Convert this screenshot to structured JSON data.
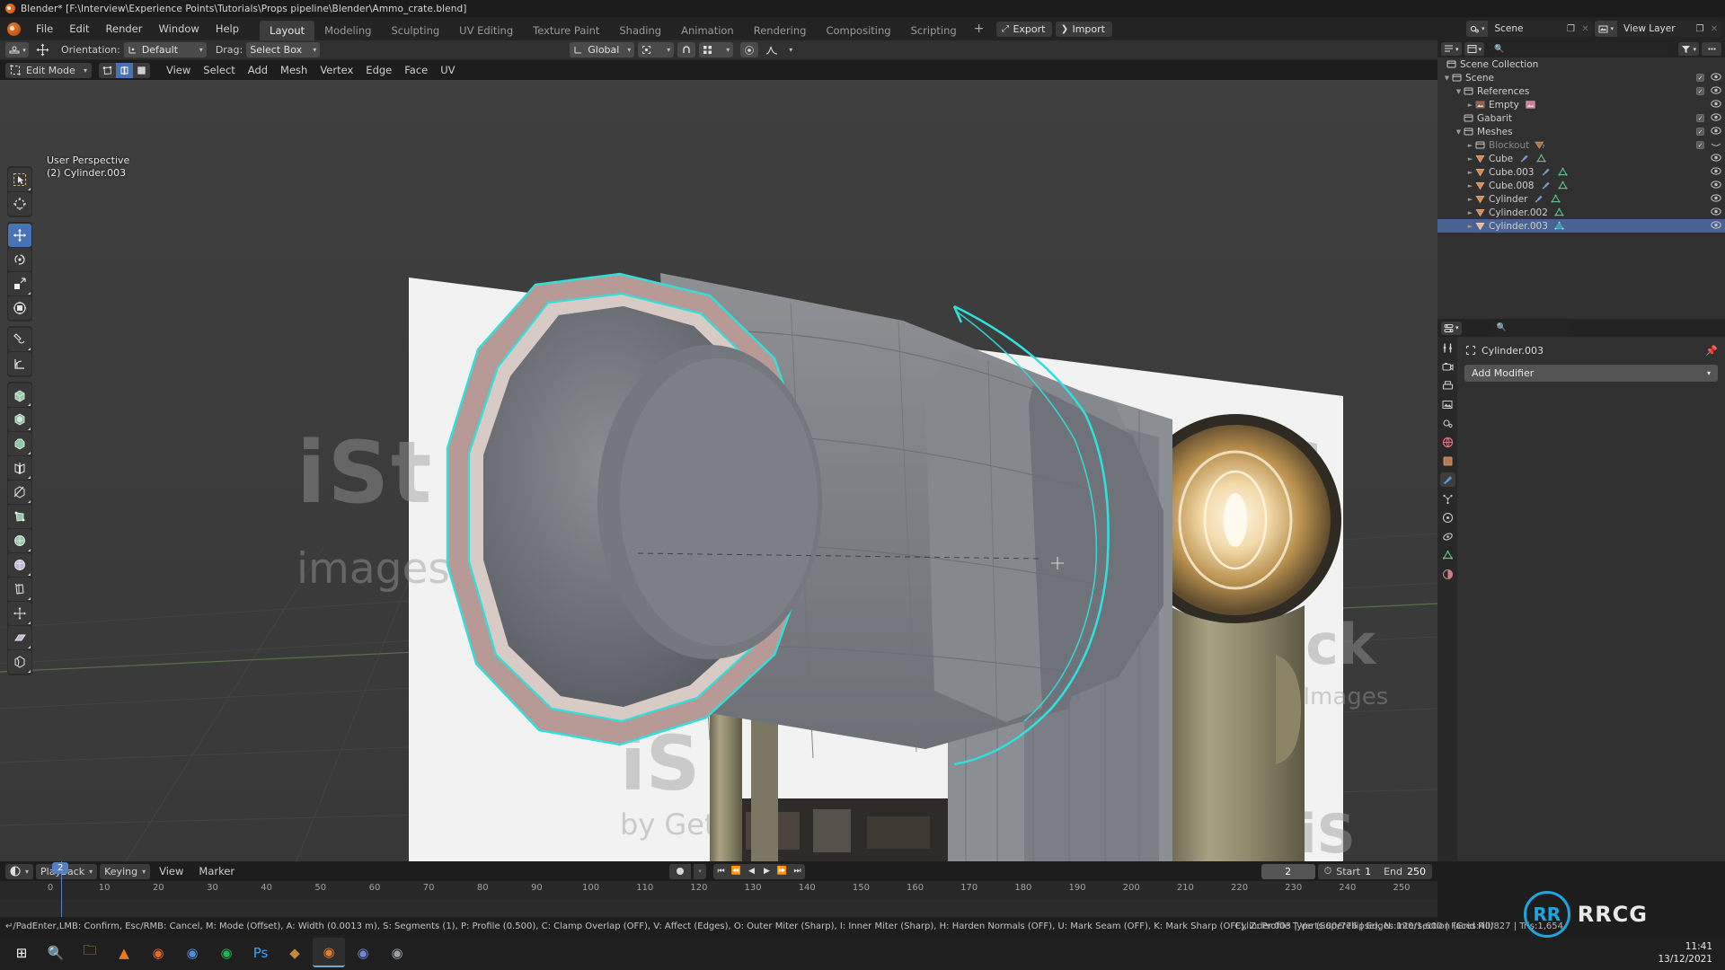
{
  "window": {
    "title": "Blender* [F:\\Interview\\Experience Points\\Tutorials\\Props pipeline\\Blender\\Ammo_crate.blend]",
    "logo_icon": "blender-logo-icon"
  },
  "topbar": {
    "menus": [
      "File",
      "Edit",
      "Render",
      "Window",
      "Help"
    ],
    "workspaces": [
      {
        "label": "Layout",
        "active": true
      },
      {
        "label": "Modeling",
        "active": false
      },
      {
        "label": "Sculpting",
        "active": false
      },
      {
        "label": "UV Editing",
        "active": false
      },
      {
        "label": "Texture Paint",
        "active": false
      },
      {
        "label": "Shading",
        "active": false
      },
      {
        "label": "Animation",
        "active": false
      },
      {
        "label": "Rendering",
        "active": false
      },
      {
        "label": "Compositing",
        "active": false
      },
      {
        "label": "Scripting",
        "active": false
      }
    ],
    "add_workspace": "+",
    "pills": [
      {
        "label": "Export",
        "icon": "export-icon"
      },
      {
        "label": "Import",
        "icon": "import-icon"
      }
    ],
    "scene_field": {
      "icon": "scene-icon",
      "value": "Scene",
      "copy": "new-scene-icon",
      "close": "x-icon"
    },
    "viewlayer_field": {
      "icon": "viewlayer-icon",
      "value": "View Layer",
      "copy": "new-layer-icon",
      "close": "x-icon"
    }
  },
  "tool_settings": {
    "active_tool_icon": "move-tool-icon",
    "gizmo_icon": "transform-gizmo-icon",
    "orientation_label": "Orientation:",
    "orientation_value": "Default",
    "drag_label": "Drag:",
    "drag_value": "Select Box"
  },
  "transform_header": {
    "orientation": "Global",
    "pivot_icon": "pivot-point-icon",
    "snap_icon": "snap-magnet-icon",
    "snap_to_icon": "snap-target-icon",
    "proportional_icon": "proportional-edit-icon",
    "falloff_icon": "falloff-curve-icon"
  },
  "viewport_header": {
    "mode": "Edit Mode",
    "select_modes": [
      {
        "name": "vertex-select",
        "active": false
      },
      {
        "name": "edge-select",
        "active": true
      },
      {
        "name": "face-select",
        "active": false
      }
    ],
    "menus": [
      "View",
      "Select",
      "Add",
      "Mesh",
      "Vertex",
      "Edge",
      "Face",
      "UV"
    ],
    "right_buttons": [
      {
        "name": "visibility-icon",
        "active": false
      },
      {
        "name": "gizmo-toggle-icon",
        "active": true
      },
      {
        "name": "overlays-toggle-icon",
        "active": true
      },
      {
        "name": "xray-toggle-icon",
        "active": false
      }
    ],
    "shading_modes": [
      {
        "name": "wireframe-shading",
        "active": false
      },
      {
        "name": "solid-shading",
        "active": true
      },
      {
        "name": "material-preview-shading",
        "active": false
      },
      {
        "name": "rendered-shading",
        "active": false
      }
    ]
  },
  "viewport": {
    "overlay_line1": "User Perspective",
    "overlay_line2": "(2) Cylinder.003"
  },
  "toolbar": {
    "groups": [
      [
        {
          "name": "tweak-select-box-tool",
          "active": false
        },
        {
          "name": "cursor-tool",
          "active": false
        }
      ],
      [
        {
          "name": "move-tool",
          "active": true
        },
        {
          "name": "rotate-tool",
          "active": false
        },
        {
          "name": "scale-tool",
          "active": false
        },
        {
          "name": "transform-tool",
          "active": false
        }
      ],
      [
        {
          "name": "annotate-tool",
          "active": false
        },
        {
          "name": "measure-tool",
          "active": false
        }
      ],
      [
        {
          "name": "extrude-region-tool",
          "active": false
        },
        {
          "name": "inset-faces-tool",
          "active": false
        },
        {
          "name": "bevel-tool",
          "active": false
        },
        {
          "name": "loop-cut-tool",
          "active": false
        },
        {
          "name": "knife-tool",
          "active": false
        },
        {
          "name": "poly-build-tool",
          "active": false
        },
        {
          "name": "spin-tool",
          "active": false
        },
        {
          "name": "smooth-tool",
          "active": false
        },
        {
          "name": "edge-slide-tool",
          "active": false
        },
        {
          "name": "shrink-fatten-tool",
          "active": false
        },
        {
          "name": "shear-tool",
          "active": false
        },
        {
          "name": "rip-region-tool",
          "active": false
        }
      ]
    ]
  },
  "outliner": {
    "header": {
      "editor_type_icon": "outliner-icon",
      "display_mode_icon": "view-layer-icon",
      "filter_icon": "filter-icon",
      "search_placeholder": "",
      "search_icon": "search-icon"
    },
    "root": "Scene Collection",
    "rows": [
      {
        "indent": 0,
        "tri": "down",
        "icon": "collection-icon",
        "label": "Scene",
        "checkbox": true,
        "eye": true,
        "selected": false,
        "dim": false,
        "extra": []
      },
      {
        "indent": 1,
        "tri": "down",
        "icon": "collection-icon",
        "label": "References",
        "checkbox": true,
        "eye": true,
        "selected": false,
        "dim": false,
        "extra": []
      },
      {
        "indent": 2,
        "tri": "right",
        "icon": "image-empty-icon",
        "label": "Empty",
        "checkbox": false,
        "eye": true,
        "selected": false,
        "dim": false,
        "extra": [
          "image-data-icon"
        ]
      },
      {
        "indent": 1,
        "tri": "none",
        "icon": "collection-icon",
        "label": "Gabarit",
        "checkbox": true,
        "eye": true,
        "selected": false,
        "dim": false,
        "extra": []
      },
      {
        "indent": 1,
        "tri": "down",
        "icon": "collection-icon",
        "label": "Meshes",
        "checkbox": true,
        "eye": true,
        "selected": false,
        "dim": false,
        "extra": []
      },
      {
        "indent": 2,
        "tri": "right",
        "icon": "collection-icon",
        "label": "Blockout",
        "checkbox": true,
        "eye": false,
        "selected": false,
        "dim": true,
        "extra": [
          "mesh-count-7-icon"
        ]
      },
      {
        "indent": 2,
        "tri": "right",
        "icon": "mesh-object-icon",
        "label": "Cube",
        "checkbox": false,
        "eye": true,
        "selected": false,
        "dim": false,
        "extra": [
          "modifier-icon",
          "mesh-data-icon"
        ]
      },
      {
        "indent": 2,
        "tri": "right",
        "icon": "mesh-object-icon",
        "label": "Cube.003",
        "checkbox": false,
        "eye": true,
        "selected": false,
        "dim": false,
        "extra": [
          "modifier-icon",
          "mesh-data-icon"
        ]
      },
      {
        "indent": 2,
        "tri": "right",
        "icon": "mesh-object-icon",
        "label": "Cube.008",
        "checkbox": false,
        "eye": true,
        "selected": false,
        "dim": false,
        "extra": [
          "modifier-icon",
          "mesh-data-icon"
        ]
      },
      {
        "indent": 2,
        "tri": "right",
        "icon": "mesh-object-icon",
        "label": "Cylinder",
        "checkbox": false,
        "eye": true,
        "selected": false,
        "dim": false,
        "extra": [
          "modifier-icon",
          "mesh-data-icon"
        ]
      },
      {
        "indent": 2,
        "tri": "right",
        "icon": "mesh-object-icon",
        "label": "Cylinder.002",
        "checkbox": false,
        "eye": true,
        "selected": false,
        "dim": false,
        "extra": [
          "mesh-data-icon"
        ]
      },
      {
        "indent": 2,
        "tri": "right",
        "icon": "mesh-object-icon",
        "label": "Cylinder.003",
        "checkbox": false,
        "eye": true,
        "selected": true,
        "dim": false,
        "extra": [
          "mesh-data-icon"
        ]
      }
    ]
  },
  "properties": {
    "header": {
      "editor_icon": "properties-icon",
      "search_icon": "search-icon",
      "search_placeholder": ""
    },
    "tabs": [
      {
        "name": "tool-tab",
        "active": false
      },
      {
        "name": "render-tab",
        "active": false
      },
      {
        "name": "output-tab",
        "active": false
      },
      {
        "name": "view-layer-tab",
        "active": false
      },
      {
        "name": "scene-tab",
        "active": false
      },
      {
        "name": "world-tab",
        "active": false
      },
      {
        "name": "object-tab",
        "active": false
      },
      {
        "name": "modifier-tab",
        "active": true
      },
      {
        "name": "particles-tab",
        "active": false
      },
      {
        "name": "physics-tab",
        "active": false
      },
      {
        "name": "constraints-tab",
        "active": false
      },
      {
        "name": "object-data-tab",
        "active": false
      },
      {
        "name": "material-tab",
        "active": false
      }
    ],
    "breadcrumb_icon": "object-icon",
    "breadcrumb": "Cylinder.003",
    "pin_icon": "pin-icon",
    "add_modifier": "Add Modifier"
  },
  "timeline": {
    "editor_icon": "timeline-icon",
    "menus_dropdowns": [
      "Playback",
      "Keying"
    ],
    "menus": [
      "View",
      "Marker"
    ],
    "record_icon": "auto-keying-icon",
    "transport": [
      "jump-to-start-icon",
      "jump-to-prev-keyframe-icon",
      "play-reverse-icon",
      "play-icon",
      "jump-to-next-keyframe-icon",
      "jump-to-end-icon"
    ],
    "current_frame": "2",
    "stopwatch_icon": "use-preview-range-icon",
    "start_label": "Start",
    "start_value": "1",
    "end_label": "End",
    "end_value": "250",
    "ruler_ticks": [
      "0",
      "10",
      "20",
      "30",
      "40",
      "50",
      "60",
      "70",
      "80",
      "90",
      "100",
      "110",
      "120",
      "130",
      "140",
      "150",
      "160",
      "170",
      "180",
      "190",
      "200",
      "210",
      "220",
      "230",
      "240",
      "250"
    ],
    "playhead_frame": "2"
  },
  "statusbar": {
    "keymap": "↵/PadEnter,LMB: Confirm, Esc/RMB: Cancel, M: Mode (Offset), A: Width (0.0013 m), S: Segments (1), P: Profile (0.500), C: Clamp Overlap (OFF), V: Affect (Edges), O: Outer Miter (Sharp), I: Inner Miter (Sharp), H: Harden Normals (OFF), U: Mark Seam (OFF), K: Mark Sharp (OFF), Z: Profile Type (Superellipse), N: Intersection (Grid Fill)",
    "stats": "Cylinder.003 | Verts:80/776 | Edges:120/1,600 | Faces:40/827 | Tris:1,654"
  },
  "taskbar": {
    "items": [
      {
        "name": "start-button-icon",
        "glyph": "⊞",
        "color": "#ffffff",
        "active": false
      },
      {
        "name": "search-icon",
        "glyph": "🔍",
        "color": "#dddddd",
        "active": false
      },
      {
        "name": "file-explorer-icon",
        "glyph": "🗀",
        "color": "#e8b050",
        "active": false
      },
      {
        "name": "vlc-icon",
        "glyph": "▲",
        "color": "#e87b1f",
        "active": false
      },
      {
        "name": "firefox-icon",
        "glyph": "◉",
        "color": "#e86a1f",
        "active": false
      },
      {
        "name": "chrome-icon",
        "glyph": "◉",
        "color": "#4a90d9",
        "active": false
      },
      {
        "name": "spotify-icon",
        "glyph": "◉",
        "color": "#1db954",
        "active": false
      },
      {
        "name": "photoshop-icon",
        "glyph": "Ps",
        "color": "#31a8ff",
        "active": false
      },
      {
        "name": "substance-icon",
        "glyph": "◆",
        "color": "#c08a3e",
        "active": false
      },
      {
        "name": "blender-icon",
        "glyph": "◉",
        "color": "#e87d26",
        "active": true
      },
      {
        "name": "discord-icon",
        "glyph": "◉",
        "color": "#7289da",
        "active": false
      },
      {
        "name": "app-icon",
        "glyph": "◉",
        "color": "#9aa0a6",
        "active": false
      }
    ],
    "clock_time": "11:41",
    "clock_date": "13/12/2021"
  },
  "watermark": {
    "mark": "RR",
    "text": "RRCG"
  },
  "colors": {
    "accent_blue": "#4772b3",
    "selection_cyan": "#2fe0dc",
    "header_bg": "#232323",
    "editor_bg": "#303030",
    "viewport_bg": "#3c3c3c"
  }
}
